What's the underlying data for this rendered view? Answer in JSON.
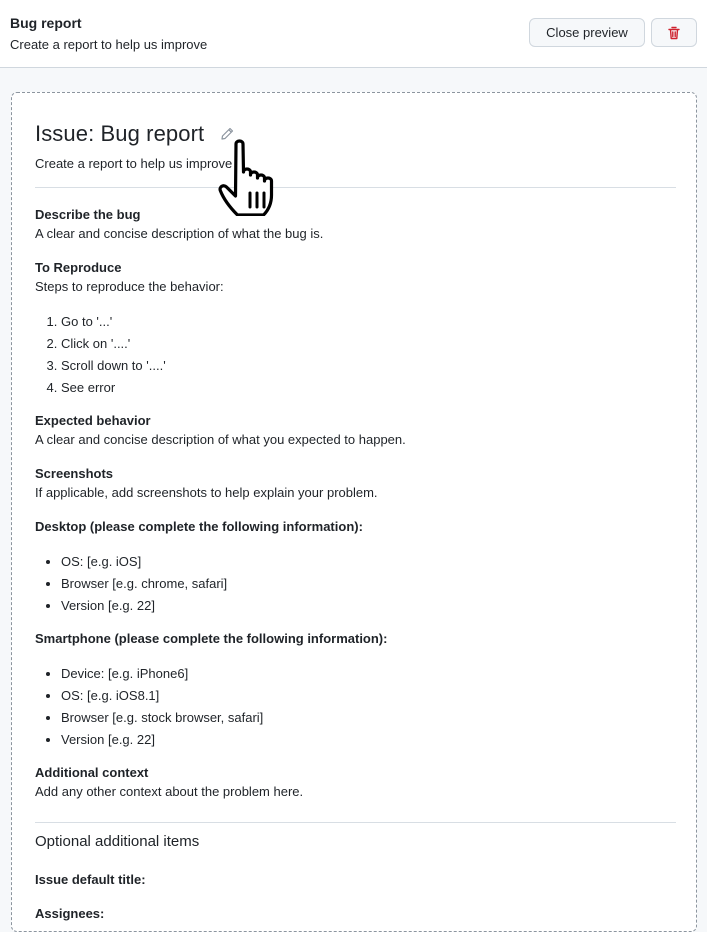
{
  "header": {
    "title": "Bug report",
    "subtitle": "Create a report to help us improve",
    "close_preview_label": "Close preview",
    "delete_icon": "trash-icon"
  },
  "issue": {
    "title": "Issue: Bug report",
    "edit_icon": "pencil-icon",
    "description": "Create a report to help us improve"
  },
  "sections": {
    "describe": {
      "heading": "Describe the bug",
      "text": "A clear and concise description of what the bug is."
    },
    "reproduce": {
      "heading": "To Reproduce",
      "text": "Steps to reproduce the behavior:",
      "steps": [
        "Go to '...'",
        "Click on '....'",
        "Scroll down to '....'",
        "See error"
      ]
    },
    "expected": {
      "heading": "Expected behavior",
      "text": "A clear and concise description of what you expected to happen."
    },
    "screenshots": {
      "heading": "Screenshots",
      "text": "If applicable, add screenshots to help explain your problem."
    },
    "desktop": {
      "heading": "Desktop (please complete the following information):",
      "items": [
        "OS: [e.g. iOS]",
        "Browser [e.g. chrome, safari]",
        "Version [e.g. 22]"
      ]
    },
    "smartphone": {
      "heading": "Smartphone (please complete the following information):",
      "items": [
        "Device: [e.g. iPhone6]",
        "OS: [e.g. iOS8.1]",
        "Browser [e.g. stock browser, safari]",
        "Version [e.g. 22]"
      ]
    },
    "context": {
      "heading": "Additional context",
      "text": "Add any other context about the problem here."
    }
  },
  "optional": {
    "title": "Optional additional items",
    "default_title_label": "Issue default title:",
    "assignees_label": "Assignees:"
  },
  "colors": {
    "danger": "#cf222e",
    "border": "#d0d7de",
    "canvas": "#f6f8fa"
  }
}
